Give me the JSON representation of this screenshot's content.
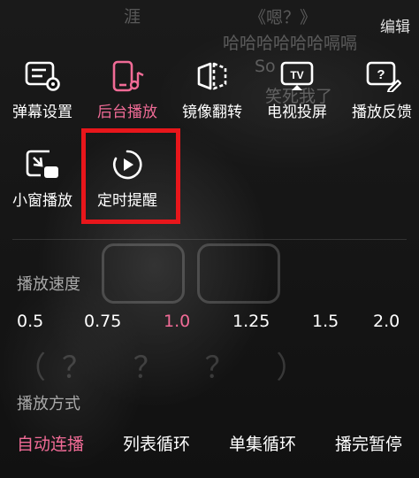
{
  "overlay": {
    "edit_label": "编辑",
    "danmaku": [
      "涯",
      "《嗯？》",
      "哈哈哈哈哈哈嗝嗝",
      "So",
      "笑死我了",
      "（？ ？ ？ ）"
    ]
  },
  "functions": [
    {
      "label": "弹幕设置",
      "icon": "danmaku-settings-icon",
      "active": false
    },
    {
      "label": "后台播放",
      "icon": "background-play-icon",
      "active": true
    },
    {
      "label": "镜像翻转",
      "icon": "mirror-flip-icon",
      "active": false
    },
    {
      "label": "电视投屏",
      "icon": "tv-cast-icon",
      "active": false
    },
    {
      "label": "播放反馈",
      "icon": "feedback-icon",
      "active": false
    },
    {
      "label": "小窗播放",
      "icon": "mini-window-icon",
      "active": false
    },
    {
      "label": "定时提醒",
      "icon": "timer-icon",
      "active": false
    }
  ],
  "speed": {
    "title": "播放速度",
    "options": [
      "0.5",
      "0.75",
      "1.0",
      "1.25",
      "1.5",
      "2.0"
    ],
    "selected": "1.0"
  },
  "playmode": {
    "title": "播放方式",
    "options": [
      "自动连播",
      "列表循环",
      "单集循环",
      "播完暂停"
    ],
    "selected": "自动连播"
  },
  "colors": {
    "accent": "#f06b96",
    "highlight_box": "#e8161b"
  }
}
